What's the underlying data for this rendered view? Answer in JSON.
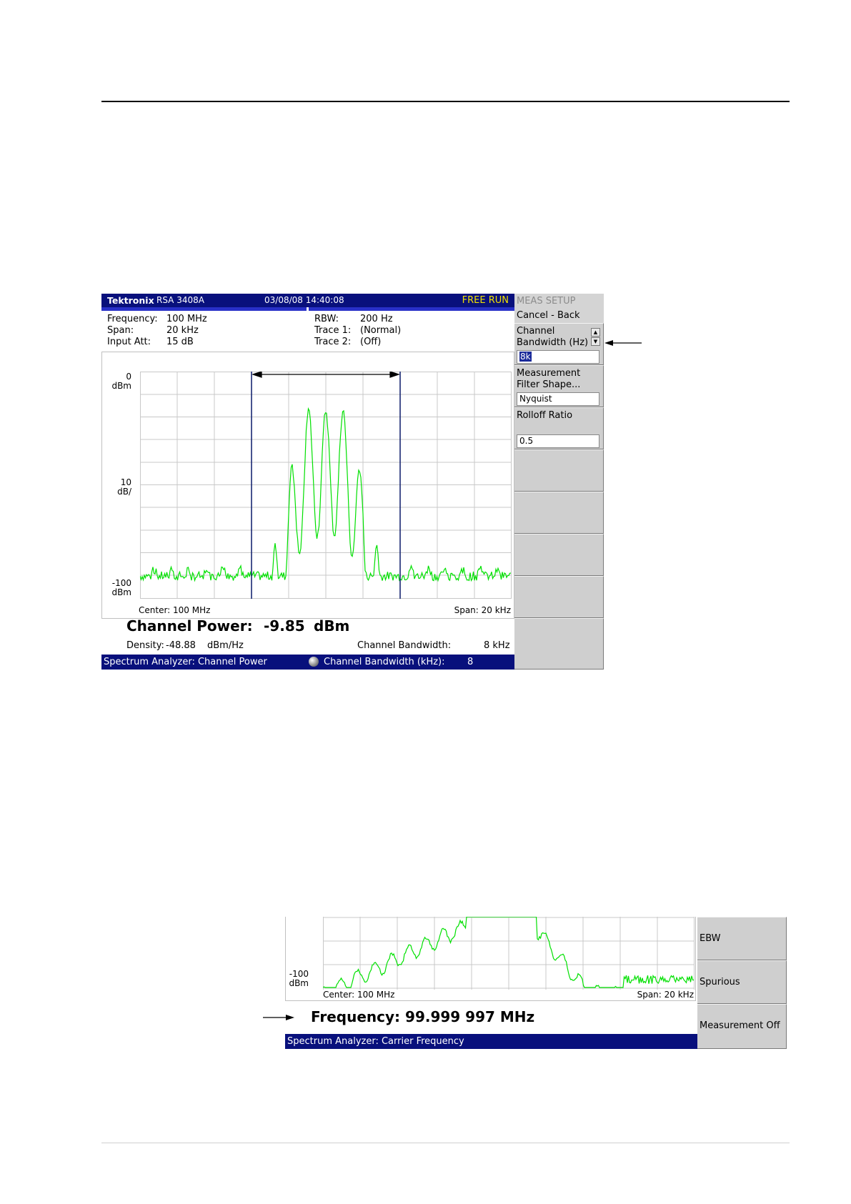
{
  "screen1": {
    "brand": "Tektronix",
    "model": "RSA 3408A",
    "datetime": "03/08/08 14:40:08",
    "run_status": "FREE RUN",
    "settings": {
      "frequency_label": "Frequency:",
      "frequency_value": "100 MHz",
      "span_label": "Span:",
      "span_value": "20 kHz",
      "input_att_label": "Input Att:",
      "input_att_value": "15 dB",
      "rbw_label": "RBW:",
      "rbw_value": "200 Hz",
      "trace1_label": "Trace 1:",
      "trace1_value": "(Normal)",
      "trace2_label": "Trace 2:",
      "trace2_value": "(Off)"
    },
    "y_top_value": "0",
    "y_top_unit": "dBm",
    "y_scale_value": "10",
    "y_scale_unit": "dB/",
    "y_bottom_value": "-100",
    "y_bottom_unit": "dBm",
    "center_label": "Center: 100 MHz",
    "span_label": "Span: 20 kHz",
    "channel_power_label": "Channel Power:",
    "channel_power_value": "-9.85",
    "channel_power_unit": "dBm",
    "density_label": "Density:",
    "density_value": "-48.88",
    "density_unit": "dBm/Hz",
    "channel_bw_label": "Channel Bandwidth:",
    "channel_bw_value": "8 kHz",
    "status_left": "Spectrum Analyzer: Channel Power",
    "status_right_label": "Channel Bandwidth (kHz):",
    "status_right_value": "8",
    "menu": {
      "header": "MEAS SETUP",
      "cancel": "Cancel - Back",
      "channel_bw_line1": "Channel",
      "channel_bw_line2": "Bandwidth (Hz)",
      "channel_bw_value": "8k",
      "filter_line1": "Measurement",
      "filter_line2": "Filter Shape...",
      "filter_value": "Nyquist",
      "rolloff_label": "Rolloff Ratio",
      "rolloff_value": "0.5"
    }
  },
  "screen2": {
    "y_bottom_value": "-100",
    "y_bottom_unit": "dBm",
    "center_label": "Center: 100 MHz",
    "span_label": "Span: 20 kHz",
    "frequency_readout": "Frequency: 99.999 997 MHz",
    "status_left": "Spectrum Analyzer: Carrier Frequency",
    "menu": [
      "EBW",
      "Spurious",
      "Measurement Off"
    ]
  },
  "colors": {
    "title_bar": "#08107c",
    "trace": "#00e000",
    "run_status": "#f0e000",
    "menu_bg": "#cfcfcf"
  }
}
